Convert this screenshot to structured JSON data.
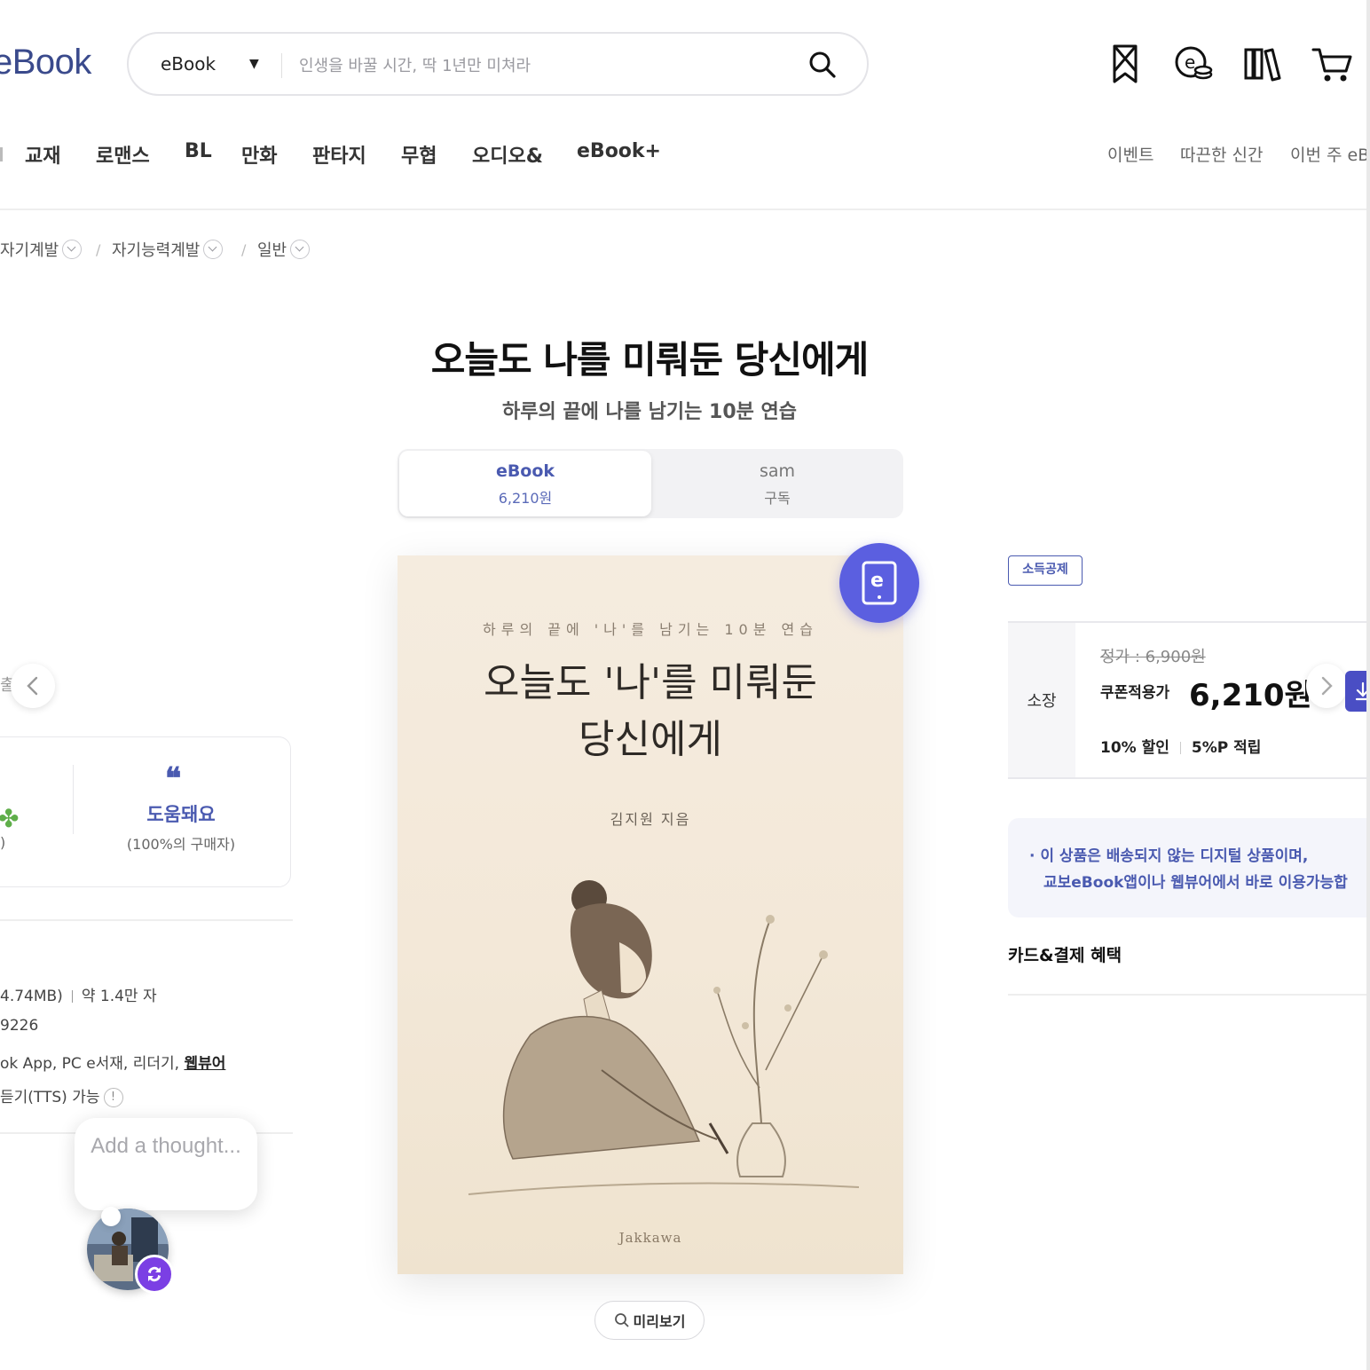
{
  "header": {
    "logo": "eBook",
    "search": {
      "category": "eBook",
      "placeholder": "인생을 바꿀 시간, 딱 1년만 미쳐라"
    },
    "icons": [
      "bookmark-icon",
      "ecash-icon",
      "library-icon",
      "cart-icon"
    ]
  },
  "nav": {
    "categories": [
      "교재",
      "로맨스",
      "BL",
      "만화",
      "판타지",
      "무협",
      "오디오&",
      "eBook+"
    ],
    "links": [
      "이벤트",
      "따끈한 신간",
      "이번 주 eB"
    ]
  },
  "breadcrumb": [
    "자기계발",
    "자기능력계발",
    "일반"
  ],
  "product": {
    "title": "오늘도 나를 미뤄둔 당신에게",
    "subtitle": "하루의 끝에 나를 남기는 10분 연습",
    "tabs": [
      {
        "name": "eBook",
        "sub": "6,210원"
      },
      {
        "name": "sam",
        "sub": "구독"
      }
    ],
    "cover": {
      "kicker": "하루의 끝에 '나'를 남기는 10분 연습",
      "title_line1": "오늘도 '나'를 미뤄둔",
      "title_line2": "당신에게",
      "author": "김지원 지음",
      "publisher": "Jakkawa"
    },
    "preview_label": "미리보기"
  },
  "left": {
    "prev_text": "출간",
    "review": {
      "label": "도움돼요",
      "sub": "(100%의 구매자)",
      "partial_paren": ")"
    },
    "info": {
      "size": "4.74MB)",
      "chars": "약 1.4만 자",
      "isbn": "9226",
      "devices": "ok App, PC e서재, 리더기, ",
      "webviewer": "웹뷰어",
      "tts": "듣기(TTS) 가능"
    }
  },
  "thought": {
    "placeholder": "Add a thought..."
  },
  "right": {
    "tax_badge": "소득공제",
    "price": {
      "label": "소장",
      "list": "정가 : 6,900원",
      "coupon_label": "쿠폰적용가",
      "sale": "6,210원",
      "discount": "10% 할인",
      "points": "5%P 적립"
    },
    "notice_line1": "· 이 상품은 배송되지 않는 디지털 상품이며,",
    "notice_line2": "교보eBook앱이나 웹뷰어에서 바로 이용가능합",
    "card_title": "카드&결제 혜택"
  },
  "colors": {
    "brand": "#4a5ab0",
    "badge": "#5b5fe0",
    "avatar_sync": "#7b3fe4"
  }
}
